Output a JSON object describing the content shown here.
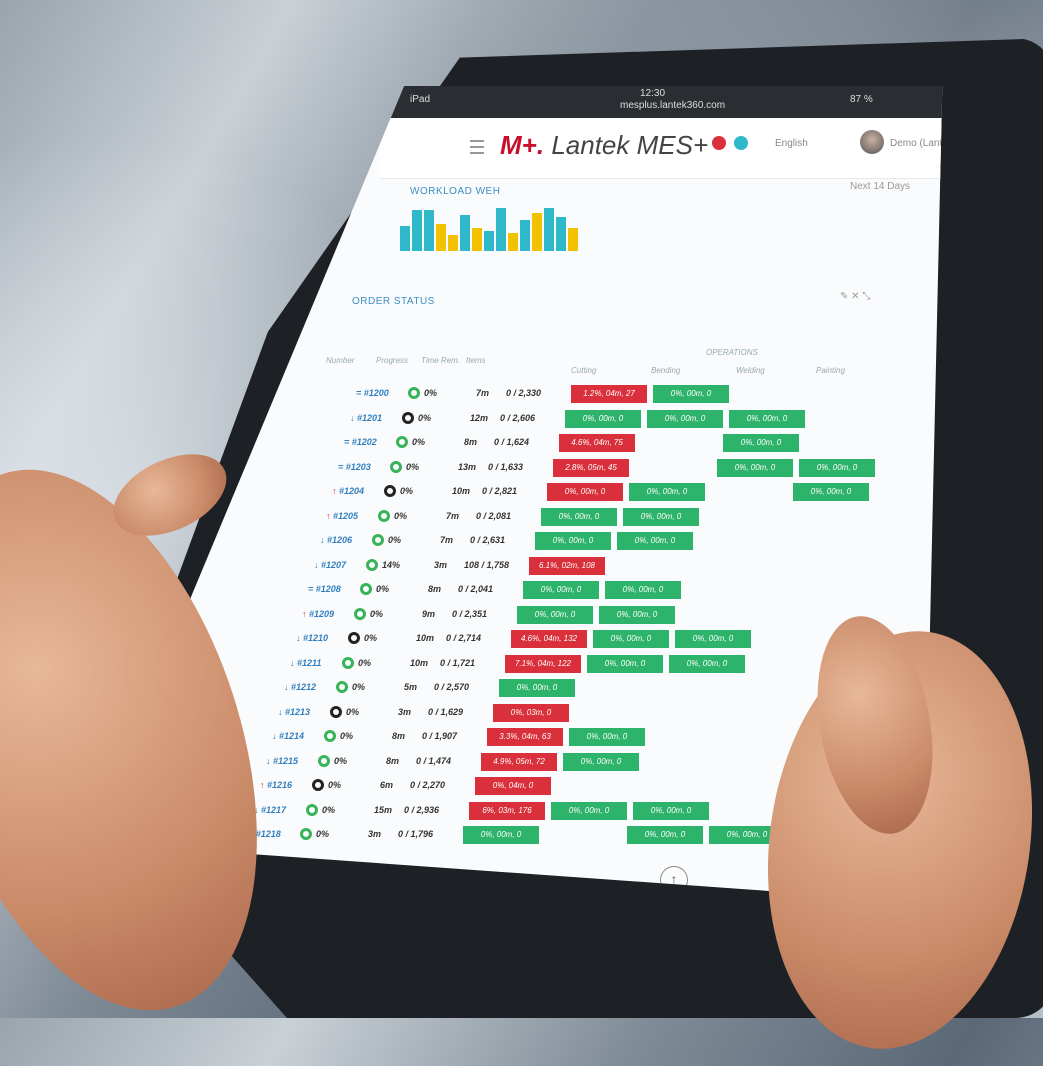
{
  "status_bar": {
    "left": "iPad",
    "time": "12:30",
    "url": "mesplus.lantek360.com",
    "battery": "87 %"
  },
  "app": {
    "logo_mark": "M+.",
    "logo_text": "Lantek MES+",
    "language": "English",
    "user": "Demo (Lantek)"
  },
  "workload": {
    "title": "WORKLOAD WEH",
    "note": "Next 14 Days",
    "bars": [
      {
        "color": "#2fb8c9",
        "h": 0.55
      },
      {
        "color": "#2fb8c9",
        "h": 0.9
      },
      {
        "color": "#2fb8c9",
        "h": 0.9
      },
      {
        "color": "#f2c200",
        "h": 0.6
      },
      {
        "color": "#f2c200",
        "h": 0.35
      },
      {
        "color": "#2fb8c9",
        "h": 0.8
      },
      {
        "color": "#f2c200",
        "h": 0.5
      },
      {
        "color": "#2fb8c9",
        "h": 0.45
      },
      {
        "color": "#2fb8c9",
        "h": 0.95
      },
      {
        "color": "#f2c200",
        "h": 0.4
      },
      {
        "color": "#2fb8c9",
        "h": 0.7
      },
      {
        "color": "#f2c200",
        "h": 0.85
      },
      {
        "color": "#2fb8c9",
        "h": 0.95
      },
      {
        "color": "#2fb8c9",
        "h": 0.75
      },
      {
        "color": "#f2c200",
        "h": 0.5
      }
    ]
  },
  "orders": {
    "title": "ORDER STATUS",
    "headers": {
      "number": "Number",
      "progress": "Progress",
      "time_remaining": "Time Rem.",
      "items": "Items",
      "operations": "OPERATIONS"
    },
    "operations": [
      "Cutting",
      "Bending",
      "Welding",
      "Painting"
    ],
    "rows": [
      {
        "num": "#1200",
        "arrow": "=",
        "pct": "0%",
        "time": "7m",
        "prog": "0 / 2,330",
        "ops": [
          {
            "c": 0,
            "s": "red",
            "t": "1.2%, 04m, 27"
          },
          {
            "c": 1,
            "s": "green",
            "t": "0%, 00m, 0"
          }
        ]
      },
      {
        "num": "#1201",
        "arrow": "↓",
        "pct": "0%",
        "time": "12m",
        "prog": "0 / 2,606",
        "ops": [
          {
            "c": 0,
            "s": "green",
            "t": "0%, 00m, 0"
          },
          {
            "c": 1,
            "s": "green",
            "t": "0%, 00m, 0"
          },
          {
            "c": 2,
            "s": "green",
            "t": "0%, 00m, 0"
          }
        ]
      },
      {
        "num": "#1202",
        "arrow": "=",
        "pct": "0%",
        "time": "8m",
        "prog": "0 / 1,624",
        "ops": [
          {
            "c": 0,
            "s": "red",
            "t": "4.6%, 04m, 75"
          },
          {
            "c": 2,
            "s": "green",
            "t": "0%, 00m, 0"
          }
        ]
      },
      {
        "num": "#1203",
        "arrow": "=",
        "pct": "0%",
        "time": "13m",
        "prog": "0 / 1,633",
        "ops": [
          {
            "c": 0,
            "s": "red",
            "t": "2.8%, 05m, 45"
          },
          {
            "c": 2,
            "s": "green",
            "t": "0%, 00m, 0"
          },
          {
            "c": 3,
            "s": "green",
            "t": "0%, 00m, 0"
          }
        ]
      },
      {
        "num": "#1204",
        "arrow": "↑",
        "pct": "0%",
        "time": "10m",
        "prog": "0 / 2,821",
        "ops": [
          {
            "c": 0,
            "s": "red",
            "t": "0%, 00m, 0"
          },
          {
            "c": 1,
            "s": "green",
            "t": "0%, 00m, 0"
          },
          {
            "c": 3,
            "s": "green",
            "t": "0%, 00m, 0"
          }
        ]
      },
      {
        "num": "#1205",
        "arrow": "↑",
        "pct": "0%",
        "time": "7m",
        "prog": "0 / 2,081",
        "ops": [
          {
            "c": 0,
            "s": "green",
            "t": "0%, 00m, 0"
          },
          {
            "c": 1,
            "s": "green",
            "t": "0%, 00m, 0"
          }
        ]
      },
      {
        "num": "#1206",
        "arrow": "↓",
        "pct": "0%",
        "time": "7m",
        "prog": "0 / 2,631",
        "ops": [
          {
            "c": 0,
            "s": "green",
            "t": "0%, 00m, 0"
          },
          {
            "c": 1,
            "s": "green",
            "t": "0%, 00m, 0"
          }
        ]
      },
      {
        "num": "#1207",
        "arrow": "↓",
        "pct": "14%",
        "time": "3m",
        "prog": "108 / 1,758",
        "ops": [
          {
            "c": 0,
            "s": "red",
            "t": "6.1%, 02m, 108"
          }
        ]
      },
      {
        "num": "#1208",
        "arrow": "=",
        "pct": "0%",
        "time": "8m",
        "prog": "0 / 2,041",
        "ops": [
          {
            "c": 0,
            "s": "green",
            "t": "0%, 00m, 0"
          },
          {
            "c": 1,
            "s": "green",
            "t": "0%, 00m, 0"
          }
        ]
      },
      {
        "num": "#1209",
        "arrow": "↑",
        "pct": "0%",
        "time": "9m",
        "prog": "0 / 2,351",
        "ops": [
          {
            "c": 0,
            "s": "green",
            "t": "0%, 00m, 0"
          },
          {
            "c": 1,
            "s": "green",
            "t": "0%, 00m, 0"
          }
        ]
      },
      {
        "num": "#1210",
        "arrow": "↓",
        "pct": "0%",
        "time": "10m",
        "prog": "0 / 2,714",
        "ops": [
          {
            "c": 0,
            "s": "red",
            "t": "4.6%, 04m, 132"
          },
          {
            "c": 1,
            "s": "green",
            "t": "0%, 00m, 0"
          },
          {
            "c": 2,
            "s": "green",
            "t": "0%, 00m, 0"
          }
        ]
      },
      {
        "num": "#1211",
        "arrow": "↓",
        "pct": "0%",
        "time": "10m",
        "prog": "0 / 1,721",
        "ops": [
          {
            "c": 0,
            "s": "red",
            "t": "7.1%, 04m, 122"
          },
          {
            "c": 1,
            "s": "green",
            "t": "0%, 00m, 0"
          },
          {
            "c": 2,
            "s": "green",
            "t": "0%, 00m, 0"
          }
        ]
      },
      {
        "num": "#1212",
        "arrow": "↓",
        "pct": "0%",
        "time": "5m",
        "prog": "0 / 2,570",
        "ops": [
          {
            "c": 0,
            "s": "green",
            "t": "0%, 00m, 0"
          }
        ]
      },
      {
        "num": "#1213",
        "arrow": "↓",
        "pct": "0%",
        "time": "3m",
        "prog": "0 / 1,629",
        "ops": [
          {
            "c": 0,
            "s": "red",
            "t": "0%, 03m, 0"
          }
        ]
      },
      {
        "num": "#1214",
        "arrow": "↓",
        "pct": "0%",
        "time": "8m",
        "prog": "0 / 1,907",
        "ops": [
          {
            "c": 0,
            "s": "red",
            "t": "3.3%, 04m, 63"
          },
          {
            "c": 1,
            "s": "green",
            "t": "0%, 00m, 0"
          }
        ]
      },
      {
        "num": "#1215",
        "arrow": "↓",
        "pct": "0%",
        "time": "8m",
        "prog": "0 / 1,474",
        "ops": [
          {
            "c": 0,
            "s": "red",
            "t": "4.9%, 05m, 72"
          },
          {
            "c": 1,
            "s": "green",
            "t": "0%, 00m, 0"
          }
        ]
      },
      {
        "num": "#1216",
        "arrow": "↑",
        "pct": "0%",
        "time": "6m",
        "prog": "0 / 2,270",
        "ops": [
          {
            "c": 0,
            "s": "red",
            "t": "0%, 04m, 0"
          }
        ]
      },
      {
        "num": "#1217",
        "arrow": "↓",
        "pct": "0%",
        "time": "15m",
        "prog": "0 / 2,936",
        "ops": [
          {
            "c": 0,
            "s": "red",
            "t": "6%, 03m, 176"
          },
          {
            "c": 1,
            "s": "green",
            "t": "0%, 00m, 0"
          },
          {
            "c": 2,
            "s": "green",
            "t": "0%, 00m, 0"
          }
        ]
      },
      {
        "num": "#1218",
        "arrow": "=",
        "pct": "0%",
        "time": "3m",
        "prog": "0 / 1,796",
        "ops": [
          {
            "c": 0,
            "s": "green",
            "t": "0%, 00m, 0"
          },
          {
            "c": 2,
            "s": "green",
            "t": "0%, 00m, 0"
          },
          {
            "c": 3,
            "s": "green",
            "t": "0%, 00m, 0"
          }
        ]
      }
    ]
  },
  "colors": {
    "red": "#d9303b",
    "green": "#2db36a",
    "blue": "#2f7fc0",
    "cyan": "#2fb8c9",
    "yellow": "#f2c200"
  }
}
